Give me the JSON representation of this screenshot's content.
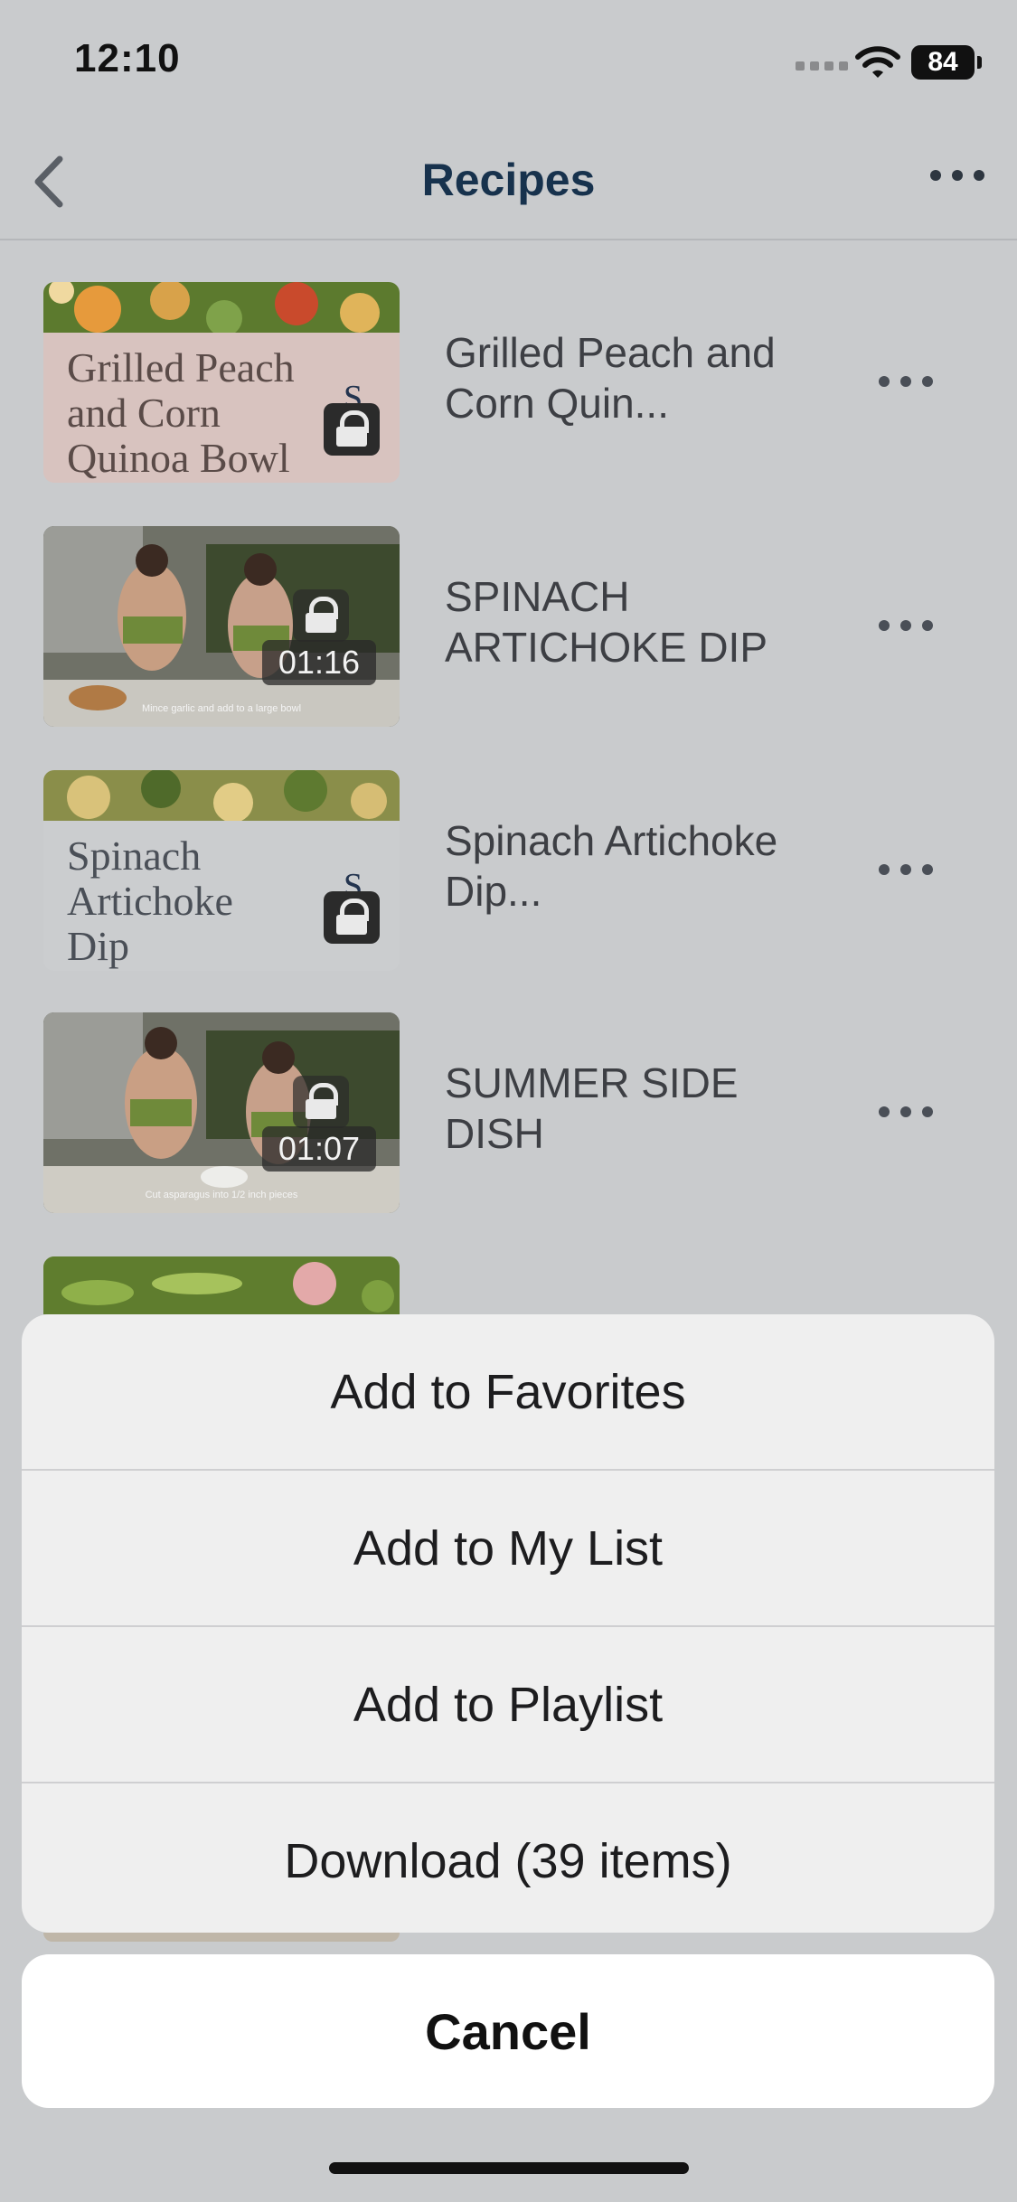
{
  "status_bar": {
    "time": "12:10",
    "battery": "84"
  },
  "nav": {
    "title": "Recipes"
  },
  "items": [
    {
      "title": "Grilled Peach and Corn Quin...",
      "thumb_text": [
        "Grilled Peach",
        "and Corn",
        "Quinoa Bowl"
      ],
      "locked": true,
      "type": "card"
    },
    {
      "title": "SPINACH ARTICHOKE DIP",
      "duration": "01:16",
      "caption": "Mince garlic and add to a large bowl",
      "locked": true,
      "type": "video"
    },
    {
      "title": "Spinach Artichoke Dip...",
      "thumb_text": [
        "Spinach",
        "Artichoke",
        "Dip"
      ],
      "locked": true,
      "type": "card"
    },
    {
      "title": "SUMMER SIDE DISH",
      "duration": "01:07",
      "caption": "Cut asparagus into 1/2 inch pieces",
      "locked": true,
      "type": "video"
    }
  ],
  "action_sheet": {
    "options": [
      "Add to Favorites",
      "Add to My List",
      "Add to Playlist",
      "Download (39 items)"
    ],
    "cancel": "Cancel"
  }
}
